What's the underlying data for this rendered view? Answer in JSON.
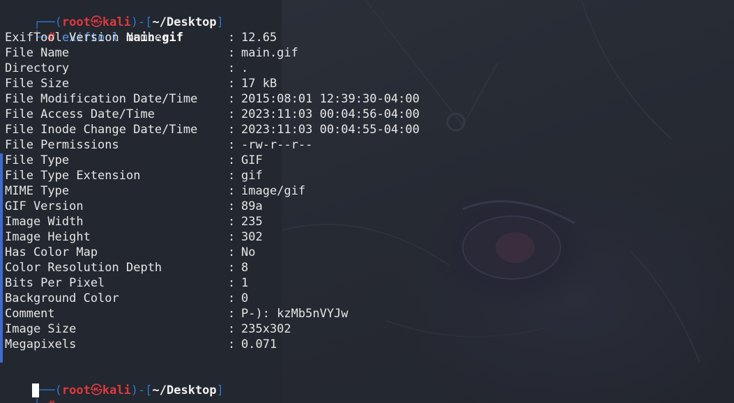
{
  "prompt": {
    "corner_top": "┌──(",
    "user": "root",
    "skull": "㉿",
    "host": "kali",
    "close_paren": ")-[",
    "path": "~/Desktop",
    "close_bracket": "]",
    "corner_bottom": "└─",
    "hash": "#"
  },
  "command": {
    "name": "exiftool",
    "arg": "main.gif"
  },
  "output": [
    {
      "key": "ExifTool Version Number",
      "sep": ":",
      "value": "12.65"
    },
    {
      "key": "File Name",
      "sep": ":",
      "value": "main.gif"
    },
    {
      "key": "Directory",
      "sep": ":",
      "value": "."
    },
    {
      "key": "File Size",
      "sep": ":",
      "value": "17 kB"
    },
    {
      "key": "File Modification Date/Time",
      "sep": ":",
      "value": "2015:08:01 12:39:30-04:00"
    },
    {
      "key": "File Access Date/Time",
      "sep": ":",
      "value": "2023:11:03 00:04:56-04:00"
    },
    {
      "key": "File Inode Change Date/Time",
      "sep": ":",
      "value": "2023:11:03 00:04:55-04:00"
    },
    {
      "key": "File Permissions",
      "sep": ":",
      "value": "-rw-r--r--"
    },
    {
      "key": "File Type",
      "sep": ":",
      "value": "GIF"
    },
    {
      "key": "File Type Extension",
      "sep": ":",
      "value": "gif"
    },
    {
      "key": "MIME Type",
      "sep": ":",
      "value": "image/gif"
    },
    {
      "key": "GIF Version",
      "sep": ":",
      "value": "89a"
    },
    {
      "key": "Image Width",
      "sep": ":",
      "value": "235"
    },
    {
      "key": "Image Height",
      "sep": ":",
      "value": "302"
    },
    {
      "key": "Has Color Map",
      "sep": ":",
      "value": "No"
    },
    {
      "key": "Color Resolution Depth",
      "sep": ":",
      "value": "8"
    },
    {
      "key": "Bits Per Pixel",
      "sep": ":",
      "value": "1"
    },
    {
      "key": "Background Color",
      "sep": ":",
      "value": "0"
    },
    {
      "key": "Comment",
      "sep": ":",
      "value": "P-): kzMb5nVYJw"
    },
    {
      "key": "Image Size",
      "sep": ":",
      "value": "235x302"
    },
    {
      "key": "Megapixels",
      "sep": ":",
      "value": "0.071"
    }
  ],
  "colors": {
    "background": "#23272f",
    "prompt_user": "#e0383e",
    "prompt_frame": "#2f74d0",
    "command": "#5a9bf0",
    "text": "#e6e6e6"
  }
}
